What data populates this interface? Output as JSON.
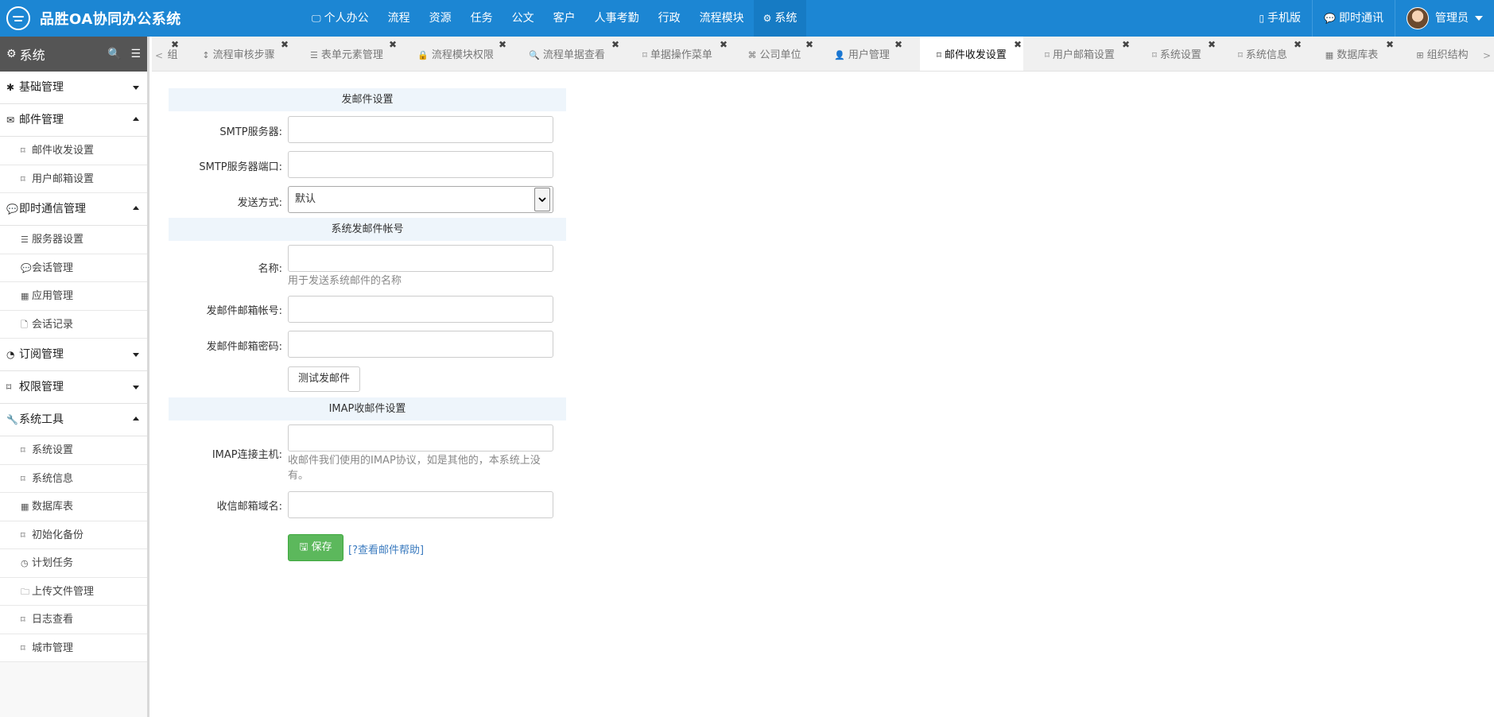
{
  "app": {
    "title": "品胜OA协同办公系统"
  },
  "nav": {
    "items": [
      {
        "label": "个人办公",
        "icon": "desktop-icon"
      },
      {
        "label": "流程"
      },
      {
        "label": "资源"
      },
      {
        "label": "任务"
      },
      {
        "label": "公文"
      },
      {
        "label": "客户"
      },
      {
        "label": "人事考勤"
      },
      {
        "label": "行政"
      },
      {
        "label": "流程模块"
      },
      {
        "label": "系统",
        "icon": "gear-icon",
        "active": true
      }
    ],
    "right": {
      "mobile": "手机版",
      "im": "即时通讯",
      "user": "管理员"
    }
  },
  "sidebar": {
    "title": "系统",
    "groups": [
      {
        "label": "基础管理"
      },
      {
        "label": "邮件管理",
        "items": [
          "邮件收发设置",
          "用户邮箱设置"
        ]
      },
      {
        "label": "即时通信管理",
        "items": [
          "服务器设置",
          "会话管理",
          "应用管理",
          "会话记录"
        ]
      },
      {
        "label": "订阅管理"
      },
      {
        "label": "权限管理"
      },
      {
        "label": "系统工具",
        "items": [
          "系统设置",
          "系统信息",
          "数据库表",
          "初始化备份",
          "计划任务",
          "上传文件管理",
          "日志查看",
          "城市管理"
        ]
      }
    ]
  },
  "tabs": {
    "scroll_left": "<",
    "scroll_right": ">",
    "items": [
      {
        "label": "组"
      },
      {
        "label": "流程审核步骤"
      },
      {
        "label": "表单元素管理"
      },
      {
        "label": "流程模块权限"
      },
      {
        "label": "流程单据查看"
      },
      {
        "label": "单据操作菜单"
      },
      {
        "label": "公司单位"
      },
      {
        "label": "用户管理"
      },
      {
        "label": "邮件收发设置",
        "active": true
      },
      {
        "label": "用户邮箱设置"
      },
      {
        "label": "系统设置"
      },
      {
        "label": "系统信息"
      },
      {
        "label": "数据库表"
      },
      {
        "label": "组织结构"
      }
    ],
    "close": "✖"
  },
  "form": {
    "send_section": "发邮件设置",
    "smtp_server_label": "SMTP服务器:",
    "smtp_port_label": "SMTP服务器端口:",
    "send_method_label": "发送方式:",
    "send_method_value": "默认",
    "account_section": "系统发邮件帐号",
    "name_label": "名称:",
    "name_help": "用于发送系统邮件的名称",
    "email_label": "发邮件邮箱帐号:",
    "password_label": "发邮件邮箱密码:",
    "test_button": "测试发邮件",
    "imap_section": "IMAP收邮件设置",
    "imap_host_label": "IMAP连接主机:",
    "imap_help": "收邮件我们使用的IMAP协议，如是其他的，本系统上没有。",
    "domain_label": "收信邮箱域名:",
    "save_button": "保存",
    "help_link": "[?查看邮件帮助]"
  }
}
